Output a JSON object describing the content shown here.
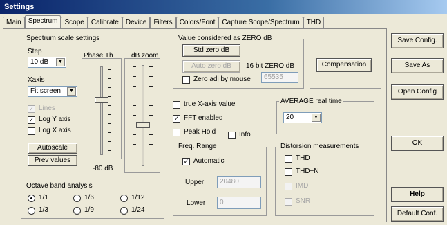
{
  "window": {
    "title": "Settings"
  },
  "tabs": [
    "Main",
    "Spectrum",
    "Scope",
    "Calibrate",
    "Device",
    "Filters",
    "Colors/Font",
    "Capture Scope/Spectrum",
    "THD"
  ],
  "active_tab": "Spectrum",
  "spectrum_scale": {
    "title": "Spectrum scale settings",
    "step_label": "Step",
    "step_value": "10 dB",
    "xaxis_label": "Xaxis",
    "xaxis_value": "Fit screen",
    "linear_label": "Lines",
    "logy_label": "Log Y axis",
    "logx_label": "Log X axis",
    "linear_checked": true,
    "logy_checked": true,
    "logx_checked": false,
    "autoscale_label": "Autoscale",
    "prev_values_label": "Prev values",
    "phase_th_label": "Phase Th",
    "db_zoom_label": "dB zoom",
    "phase_value_label": "-80 dB"
  },
  "zero_db": {
    "title": "Value considered as ZERO dB",
    "std_zero_label": "Std zero dB",
    "auto_zero_label": "Auto zero dB",
    "bit16_label": "16 bit ZERO dB",
    "bit16_value": "65535",
    "zero_adj_label": "Zero adj by mouse",
    "zero_adj_checked": false
  },
  "compensation_label": "Compensation",
  "options": {
    "true_xaxis_label": "true X-axis value",
    "fft_enabled_label": "FFT enabled",
    "peak_hold_label": "Peak Hold",
    "info_label": "Info",
    "true_xaxis_checked": false,
    "fft_enabled_checked": true,
    "peak_hold_checked": false,
    "info_checked": false
  },
  "average": {
    "title": "AVERAGE real time",
    "value": "20"
  },
  "freq_range": {
    "title": "Freq. Range",
    "automatic_label": "Automatic",
    "automatic_checked": true,
    "upper_label": "Upper",
    "upper_value": "20480",
    "lower_label": "Lower",
    "lower_value": "0"
  },
  "distortion": {
    "title": "Distorsion measurements",
    "items": [
      {
        "label": "THD",
        "checked": false,
        "enabled": true
      },
      {
        "label": "THD+N",
        "checked": false,
        "enabled": true
      },
      {
        "label": "IMD",
        "checked": false,
        "enabled": false
      },
      {
        "label": "SNR",
        "checked": false,
        "enabled": false
      }
    ]
  },
  "octave": {
    "title": "Octave band analysis",
    "options": [
      "1/1",
      "1/6",
      "1/12",
      "1/3",
      "1/9",
      "1/24"
    ],
    "selected": "1/1"
  },
  "side_buttons": {
    "save_config": "Save Config.",
    "save_as": "Save As",
    "open_config": "Open Config",
    "ok": "OK",
    "help": "Help",
    "default_conf": "Default Conf."
  }
}
